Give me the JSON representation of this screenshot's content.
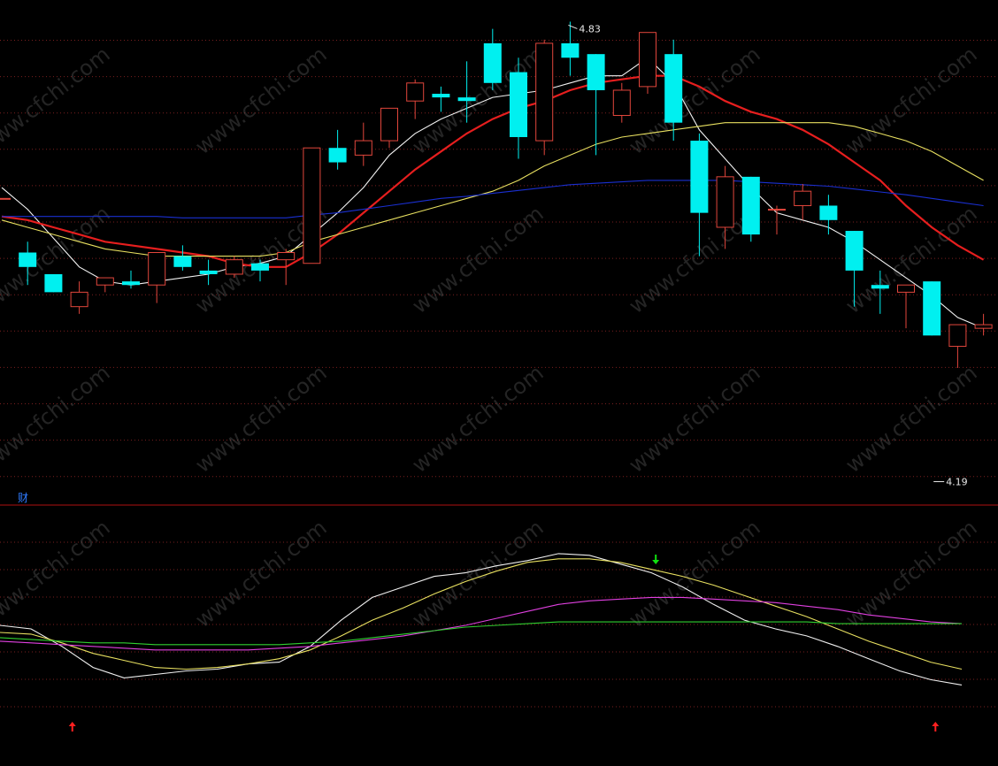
{
  "colors": {
    "background": "#000000",
    "grid": "#7a1f1f",
    "divider": "#b01010",
    "up_candle": "#e2463c",
    "down_candle": "#00f0f0",
    "ma_fast": "#f2f2f2",
    "ma_mid": "#e61e1e",
    "ma_slow": "#e8e060",
    "ma_long": "#1a2fd0",
    "ind_white": "#f0f0f0",
    "ind_yellow": "#e8e060",
    "ind_magenta": "#e040e0",
    "ind_green": "#30d030",
    "signal_up": "#ff2020",
    "signal_down": "#10e010"
  },
  "labels": {
    "high_marker": "4.83",
    "low_marker": "4.19",
    "indicator_panel_label": "财",
    "watermark": "www.cfchi.com"
  },
  "chart_data": [
    {
      "type": "candlestick",
      "title": "",
      "ylim": [
        4.16,
        4.86
      ],
      "candles": [
        {
          "o": 4.585,
          "h": 4.585,
          "l": 4.585,
          "c": 4.585
        },
        {
          "o": 4.51,
          "h": 4.525,
          "l": 4.465,
          "c": 4.49
        },
        {
          "o": 4.48,
          "h": 4.48,
          "l": 4.455,
          "c": 4.455
        },
        {
          "o": 4.435,
          "h": 4.47,
          "l": 4.425,
          "c": 4.455
        },
        {
          "o": 4.465,
          "h": 4.475,
          "l": 4.455,
          "c": 4.475
        },
        {
          "o": 4.47,
          "h": 4.485,
          "l": 4.46,
          "c": 4.465
        },
        {
          "o": 4.465,
          "h": 4.51,
          "l": 4.44,
          "c": 4.51
        },
        {
          "o": 4.505,
          "h": 4.52,
          "l": 4.485,
          "c": 4.49
        },
        {
          "o": 4.485,
          "h": 4.5,
          "l": 4.465,
          "c": 4.48
        },
        {
          "o": 4.48,
          "h": 4.505,
          "l": 4.475,
          "c": 4.5
        },
        {
          "o": 4.495,
          "h": 4.5,
          "l": 4.47,
          "c": 4.485
        },
        {
          "o": 4.5,
          "h": 4.515,
          "l": 4.465,
          "c": 4.51
        },
        {
          "o": 4.495,
          "h": 4.655,
          "l": 4.495,
          "c": 4.655
        },
        {
          "o": 4.655,
          "h": 4.68,
          "l": 4.625,
          "c": 4.635
        },
        {
          "o": 4.645,
          "h": 4.69,
          "l": 4.63,
          "c": 4.665
        },
        {
          "o": 4.665,
          "h": 4.71,
          "l": 4.655,
          "c": 4.71
        },
        {
          "o": 4.72,
          "h": 4.75,
          "l": 4.695,
          "c": 4.745
        },
        {
          "o": 4.73,
          "h": 4.74,
          "l": 4.705,
          "c": 4.725
        },
        {
          "o": 4.725,
          "h": 4.775,
          "l": 4.69,
          "c": 4.72
        },
        {
          "o": 4.8,
          "h": 4.82,
          "l": 4.735,
          "c": 4.745
        },
        {
          "o": 4.76,
          "h": 4.78,
          "l": 4.64,
          "c": 4.67
        },
        {
          "o": 4.665,
          "h": 4.805,
          "l": 4.645,
          "c": 4.8
        },
        {
          "o": 4.8,
          "h": 4.83,
          "l": 4.755,
          "c": 4.78
        },
        {
          "o": 4.785,
          "h": 4.785,
          "l": 4.645,
          "c": 4.735
        },
        {
          "o": 4.7,
          "h": 4.745,
          "l": 4.69,
          "c": 4.735
        },
        {
          "o": 4.74,
          "h": 4.81,
          "l": 4.73,
          "c": 4.815
        },
        {
          "o": 4.785,
          "h": 4.805,
          "l": 4.665,
          "c": 4.69
        },
        {
          "o": 4.665,
          "h": 4.675,
          "l": 4.505,
          "c": 4.565
        },
        {
          "o": 4.545,
          "h": 4.63,
          "l": 4.515,
          "c": 4.615
        },
        {
          "o": 4.615,
          "h": 4.615,
          "l": 4.525,
          "c": 4.535
        },
        {
          "o": 4.57,
          "h": 4.575,
          "l": 4.535,
          "c": 4.57
        },
        {
          "o": 4.575,
          "h": 4.605,
          "l": 4.555,
          "c": 4.595
        },
        {
          "o": 4.575,
          "h": 4.59,
          "l": 4.535,
          "c": 4.555
        },
        {
          "o": 4.54,
          "h": 4.54,
          "l": 4.435,
          "c": 4.485
        },
        {
          "o": 4.465,
          "h": 4.485,
          "l": 4.425,
          "c": 4.46
        },
        {
          "o": 4.455,
          "h": 4.465,
          "l": 4.405,
          "c": 4.465
        },
        {
          "o": 4.47,
          "h": 4.47,
          "l": 4.395,
          "c": 4.395
        },
        {
          "o": 4.38,
          "h": 4.41,
          "l": 4.35,
          "c": 4.41
        },
        {
          "o": 4.405,
          "h": 4.425,
          "l": 4.395,
          "c": 4.41
        }
      ],
      "moving_averages": [
        {
          "color_key": "ma_fast",
          "values": [
            4.6,
            4.57,
            4.53,
            4.49,
            4.47,
            4.465,
            4.47,
            4.475,
            4.48,
            4.49,
            4.495,
            4.505,
            4.535,
            4.565,
            4.6,
            4.645,
            4.675,
            4.695,
            4.71,
            4.725,
            4.73,
            4.735,
            4.745,
            4.755,
            4.755,
            4.78,
            4.745,
            4.68,
            4.64,
            4.6,
            4.565,
            4.555,
            4.545,
            4.525,
            4.5,
            4.475,
            4.45,
            4.42,
            4.405
          ]
        },
        {
          "color_key": "ma_mid",
          "values": [
            4.56,
            4.555,
            4.545,
            4.535,
            4.525,
            4.52,
            4.515,
            4.51,
            4.505,
            4.495,
            4.49,
            4.49,
            4.51,
            4.535,
            4.565,
            4.595,
            4.625,
            4.65,
            4.675,
            4.695,
            4.71,
            4.72,
            4.735,
            4.745,
            4.75,
            4.755,
            4.755,
            4.74,
            4.72,
            4.705,
            4.695,
            4.68,
            4.66,
            4.635,
            4.61,
            4.575,
            4.545,
            4.52,
            4.5
          ]
        },
        {
          "color_key": "ma_slow",
          "values": [
            4.555,
            4.545,
            4.535,
            4.525,
            4.515,
            4.51,
            4.505,
            4.505,
            4.505,
            4.505,
            4.505,
            4.51,
            4.525,
            4.535,
            4.545,
            4.555,
            4.565,
            4.575,
            4.585,
            4.595,
            4.61,
            4.63,
            4.645,
            4.66,
            4.67,
            4.675,
            4.68,
            4.685,
            4.69,
            4.69,
            4.69,
            4.69,
            4.69,
            4.685,
            4.675,
            4.665,
            4.65,
            4.63,
            4.61
          ]
        },
        {
          "color_key": "ma_long",
          "values": [
            4.56,
            4.56,
            4.56,
            4.56,
            4.56,
            4.56,
            4.56,
            4.558,
            4.558,
            4.558,
            4.558,
            4.558,
            4.562,
            4.565,
            4.57,
            4.575,
            4.58,
            4.585,
            4.588,
            4.592,
            4.596,
            4.6,
            4.604,
            4.606,
            4.608,
            4.61,
            4.61,
            4.61,
            4.61,
            4.608,
            4.606,
            4.604,
            4.602,
            4.598,
            4.594,
            4.59,
            4.585,
            4.58,
            4.575
          ]
        }
      ],
      "annotations": [
        {
          "text": "4.83",
          "at_index": 22,
          "price": 4.83
        },
        {
          "text": "4.19",
          "at_index": 36,
          "price": 4.19
        }
      ]
    },
    {
      "type": "line",
      "title": "",
      "ylim": [
        0,
        100
      ],
      "series": [
        {
          "color_key": "ind_white",
          "values": [
            52,
            50,
            40,
            28,
            22,
            24,
            26,
            27,
            30,
            31,
            40,
            55,
            68,
            74,
            80,
            82,
            86,
            89,
            93,
            92,
            87,
            82,
            74,
            64,
            55,
            50,
            46,
            40,
            33,
            26,
            21,
            18
          ]
        },
        {
          "color_key": "ind_yellow",
          "values": [
            48,
            47,
            42,
            36,
            32,
            28,
            27,
            28,
            30,
            33,
            38,
            46,
            55,
            62,
            70,
            77,
            83,
            88,
            90,
            90,
            88,
            84,
            80,
            75,
            69,
            63,
            57,
            50,
            43,
            37,
            31,
            27
          ]
        },
        {
          "color_key": "ind_magenta",
          "values": [
            43,
            42,
            41,
            40,
            39,
            38,
            38,
            38,
            38,
            39,
            40,
            42,
            44,
            46,
            49,
            52,
            56,
            60,
            64,
            66,
            67,
            68,
            68,
            67,
            66,
            65,
            63,
            61,
            58,
            56,
            54,
            53
          ]
        },
        {
          "color_key": "ind_green",
          "values": [
            45,
            44,
            43,
            42,
            42,
            41,
            41,
            41,
            41,
            41,
            42,
            43,
            45,
            47,
            49,
            51,
            52,
            53,
            54,
            54,
            54,
            54,
            54,
            54,
            54,
            54,
            54,
            53,
            53,
            53,
            53,
            53
          ]
        }
      ],
      "signals": [
        {
          "type": "buy",
          "at_fraction": 0.075
        },
        {
          "type": "sell",
          "at_fraction": 0.68
        },
        {
          "type": "buy",
          "at_fraction": 0.97
        }
      ]
    }
  ]
}
